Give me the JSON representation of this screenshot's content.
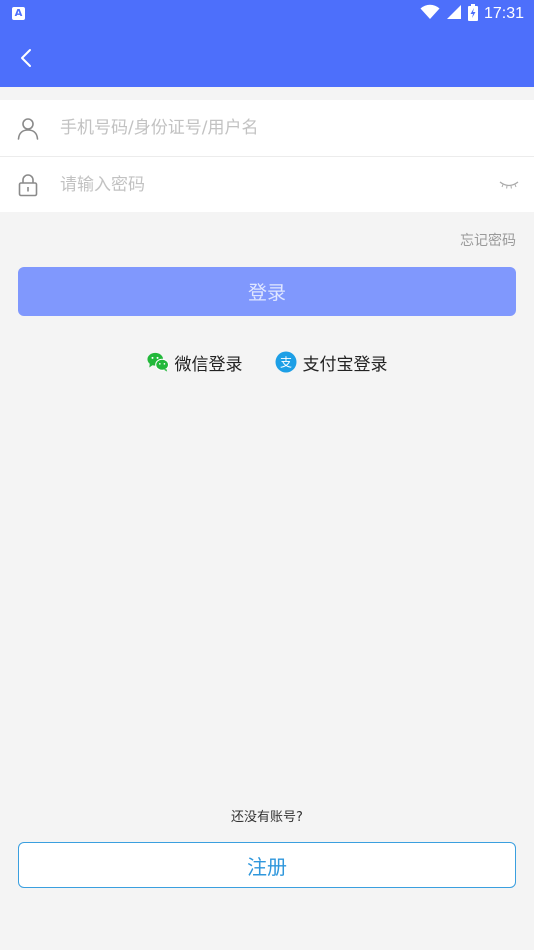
{
  "status_bar": {
    "app_icon_letter": "A",
    "time": "17:31"
  },
  "form": {
    "username_placeholder": "手机号码/身份证号/用户名",
    "password_placeholder": "请输入密码"
  },
  "forgot_password_label": "忘记密码",
  "login_button_label": "登录",
  "third_party": {
    "wechat_label": "微信登录",
    "alipay_label": "支付宝登录",
    "alipay_glyph": "支"
  },
  "footer": {
    "no_account_text": "还没有账号?",
    "register_button_label": "注册"
  },
  "colors": {
    "header": "#4d6ffb",
    "login_button": "#8098fd",
    "register_border": "#3a9fdf",
    "wechat_green": "#22b83a",
    "alipay_blue": "#1d9fe6"
  }
}
